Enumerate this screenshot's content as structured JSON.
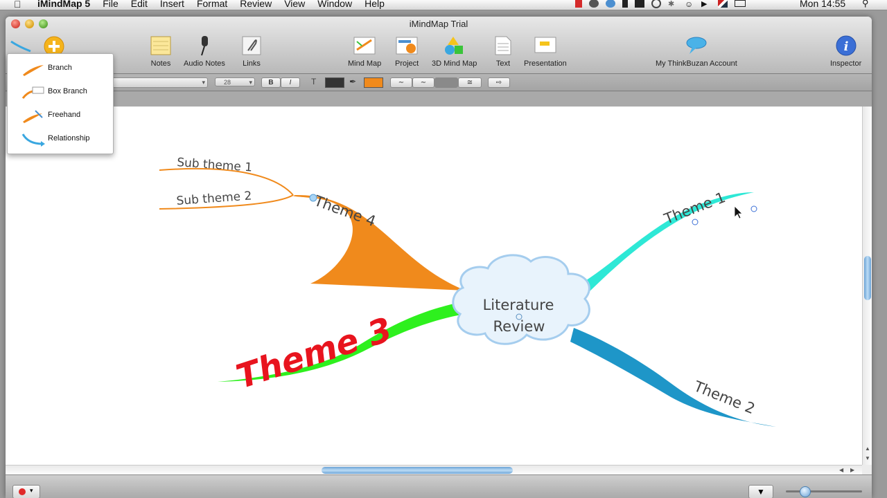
{
  "menubar": {
    "app_name": "iMindMap 5",
    "menus": [
      "File",
      "Edit",
      "Insert",
      "Format",
      "Review",
      "View",
      "Window",
      "Help"
    ],
    "clock": "Mon 14:55"
  },
  "window": {
    "title": "iMindMap Trial"
  },
  "toolbar": {
    "notes": "Notes",
    "audio_notes": "Audio Notes",
    "links": "Links",
    "mind_map": "Mind Map",
    "project": "Project",
    "mind_map_3d": "3D Mind Map",
    "text": "Text",
    "presentation": "Presentation",
    "account": "My ThinkBuzan Account",
    "inspector": "Inspector"
  },
  "formatbar": {
    "font_size": "28",
    "bold": "B",
    "italic": "I",
    "text_tool": "T",
    "text_color": "#333333",
    "branch_color": "#f08a1c"
  },
  "branch_menu": {
    "items": [
      {
        "label": "Branch",
        "icon": "branch-icon"
      },
      {
        "label": "Box Branch",
        "icon": "box-branch-icon"
      },
      {
        "label": "Freehand",
        "icon": "freehand-icon"
      },
      {
        "label": "Relationship",
        "icon": "relationship-icon"
      }
    ]
  },
  "mindmap": {
    "central": {
      "line1": "Literature",
      "line2": "Review"
    },
    "themes": {
      "theme1": {
        "label": "Theme 1",
        "color": "#2ee8d6"
      },
      "theme2": {
        "label": "Theme 2",
        "color": "#1e96c8"
      },
      "theme3": {
        "label": "Theme 3",
        "color": "#2ef01e",
        "text_color": "#e8141e"
      },
      "theme4": {
        "label": "Theme 4",
        "color": "#f08a1c"
      }
    },
    "subthemes": [
      "Sub theme 1",
      "Sub theme 2"
    ]
  }
}
